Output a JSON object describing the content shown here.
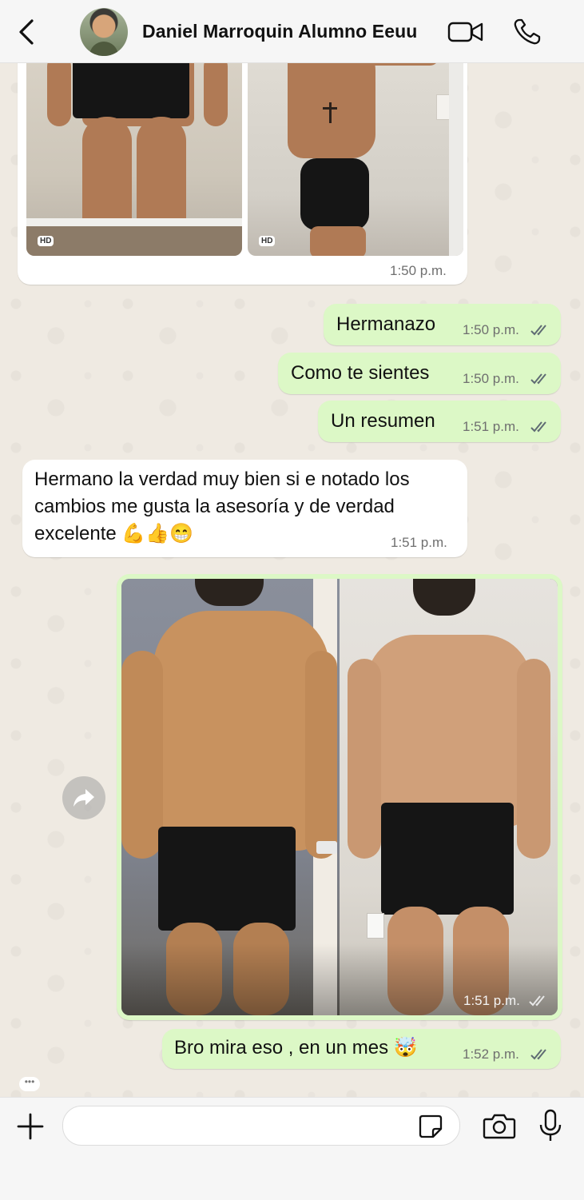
{
  "header": {
    "contact_name": "Daniel Marroquin Alumno Eeuu",
    "back_icon": "chevron-left-icon",
    "video_icon": "video-call-icon",
    "phone_icon": "phone-icon"
  },
  "messages": [
    {
      "type": "image-pair",
      "direction": "in",
      "time": "1:50 p.m.",
      "badges": [
        "HD",
        "HD"
      ]
    },
    {
      "type": "text",
      "direction": "out",
      "text": "Hermanazo",
      "time": "1:50 p.m.",
      "status": "read"
    },
    {
      "type": "text",
      "direction": "out",
      "text": "Como te sientes",
      "time": "1:50 p.m.",
      "status": "read"
    },
    {
      "type": "text",
      "direction": "out",
      "text": "Un resumen",
      "time": "1:51 p.m.",
      "status": "read"
    },
    {
      "type": "text",
      "direction": "in",
      "lines": [
        "Hermano la verdad muy bien si e notado los",
        "cambios me gusta la asesoría y de verdad",
        "excelente 💪👍😁"
      ],
      "time": "1:51 p.m."
    },
    {
      "type": "image",
      "direction": "out",
      "time": "1:51 p.m.",
      "status": "read"
    },
    {
      "type": "text",
      "direction": "out",
      "text": "Bro mira eso , en un mes 🤯",
      "time": "1:52 p.m.",
      "status": "read"
    }
  ],
  "input": {
    "placeholder": "",
    "plus_icon": "plus-icon",
    "sticker_icon": "sticker-icon",
    "camera_icon": "camera-icon",
    "mic_icon": "microphone-icon"
  },
  "colors": {
    "outgoing_bubble": "#dcf8c6",
    "incoming_bubble": "#ffffff",
    "read_checks": "#5f6b73",
    "background": "#efeae2"
  }
}
